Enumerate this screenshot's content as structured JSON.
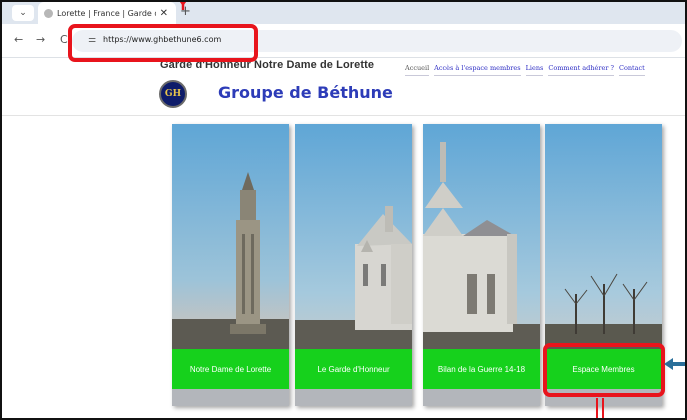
{
  "browser": {
    "tab_title": "Lorette | France | Garde d'honn",
    "tab_close": "✕",
    "new_tab": "+",
    "back_icon": "←",
    "forward_icon": "→",
    "reload_icon": "C",
    "url": "https://www.ghbethune6.com"
  },
  "header": {
    "org_title": "Garde d'Honneur Notre Dame de Lorette",
    "group_title": "Groupe de Béthune",
    "logo_letters": "GH"
  },
  "menu": [
    {
      "label": "Accueil"
    },
    {
      "label": "Accès à l'espace membres"
    },
    {
      "label": "Liens"
    },
    {
      "label": "Comment adhérer ?"
    },
    {
      "label": "Contact"
    }
  ],
  "panels": [
    {
      "label": "Notre Dame de Lorette"
    },
    {
      "label": "Le Garde d'Honneur"
    },
    {
      "label": "Bilan de la Guerre 14-18"
    },
    {
      "label": "Espace Membres"
    }
  ],
  "colors": {
    "annotation": "#e8141c",
    "panel_label_bg": "#16d11c",
    "group_title": "#2d3cb8",
    "arrow_blue": "#2a6f9a"
  }
}
